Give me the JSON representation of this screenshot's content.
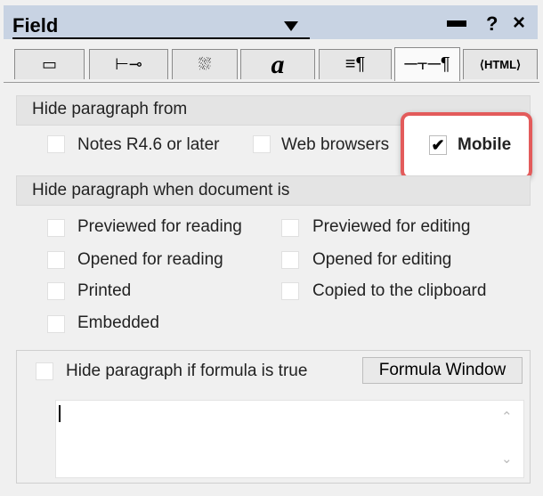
{
  "title": "Field",
  "tabs": [
    {
      "icon": "box-info-icon",
      "glyph": "▭"
    },
    {
      "icon": "font-position-icon",
      "glyph": "⊢"
    },
    {
      "icon": "color-icon",
      "glyph": "⛆"
    },
    {
      "icon": "font-icon",
      "glyph": "a"
    },
    {
      "icon": "paragraph-alignment-icon",
      "glyph": "≡"
    },
    {
      "icon": "hide-paragraph-icon",
      "glyph": "⫟"
    },
    {
      "icon": "html-icon",
      "glyph": "⟨HTML⟩"
    }
  ],
  "hide_from": {
    "header": "Hide paragraph from",
    "notes": {
      "label": "Notes R4.6 or later",
      "checked": false
    },
    "web": {
      "label": "Web browsers",
      "checked": false
    },
    "mobile": {
      "label": "Mobile",
      "checked": true
    }
  },
  "hide_when": {
    "header": "Hide paragraph when document is",
    "items": [
      {
        "label": "Previewed for reading",
        "checked": false
      },
      {
        "label": "Previewed for editing",
        "checked": false
      },
      {
        "label": "Opened for reading",
        "checked": false
      },
      {
        "label": "Opened for editing",
        "checked": false
      },
      {
        "label": "Printed",
        "checked": false
      },
      {
        "label": "Copied to the clipboard",
        "checked": false
      },
      {
        "label": "Embedded",
        "checked": false
      }
    ]
  },
  "formula": {
    "label": "Hide paragraph if formula is true",
    "checked": false,
    "button": "Formula Window",
    "value": ""
  },
  "colors": {
    "highlight": "#e35b5b",
    "titlebar": "#c8d3e3"
  }
}
